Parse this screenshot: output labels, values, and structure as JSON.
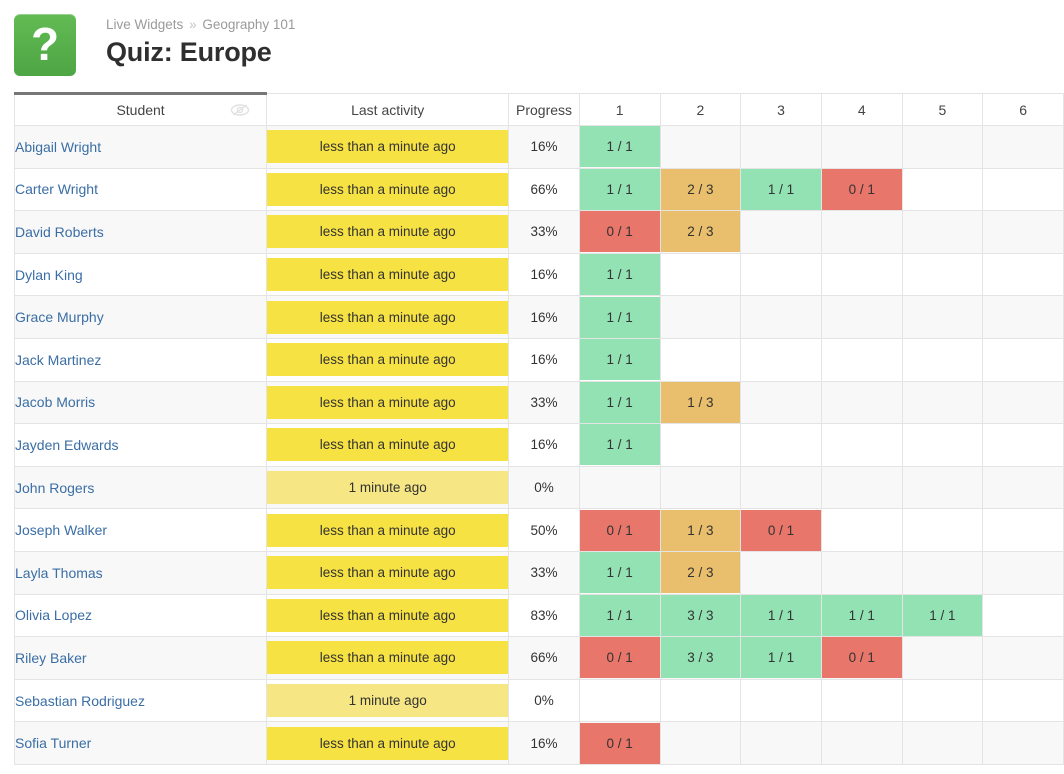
{
  "header": {
    "icon_name": "question-mark-icon",
    "icon_glyph": "?",
    "breadcrumb_root": "Live Widgets",
    "breadcrumb_separator": "»",
    "breadcrumb_course": "Geography 101",
    "title": "Quiz: Europe"
  },
  "colors": {
    "accent_green": "#4da544",
    "link_blue": "#3a6ea5",
    "score_green": "#93e2b3",
    "score_orange": "#e9bf6d",
    "score_red": "#e8766a",
    "activity_recent_yellow": "#f7e243",
    "activity_stale_yellow": "#f6e684",
    "row_stripe": "#f8f8f8"
  },
  "table": {
    "headers": {
      "student": "Student",
      "last_activity": "Last activity",
      "progress": "Progress",
      "hide_icon_name": "eye-slash-icon",
      "questions": [
        "1",
        "2",
        "3",
        "4",
        "5",
        "6"
      ]
    },
    "rows": [
      {
        "student": "Abigail Wright",
        "last_activity": "less than a minute ago",
        "activity_state": "recent",
        "progress": "16%",
        "scores": [
          {
            "text": "1 / 1",
            "state": "green"
          },
          {
            "text": "",
            "state": "none"
          },
          {
            "text": "",
            "state": "none"
          },
          {
            "text": "",
            "state": "none"
          },
          {
            "text": "",
            "state": "none"
          },
          {
            "text": "",
            "state": "none"
          }
        ]
      },
      {
        "student": "Carter Wright",
        "last_activity": "less than a minute ago",
        "activity_state": "recent",
        "progress": "66%",
        "scores": [
          {
            "text": "1 / 1",
            "state": "green"
          },
          {
            "text": "2 / 3",
            "state": "orange"
          },
          {
            "text": "1 / 1",
            "state": "green"
          },
          {
            "text": "0 / 1",
            "state": "red"
          },
          {
            "text": "",
            "state": "none"
          },
          {
            "text": "",
            "state": "none"
          }
        ]
      },
      {
        "student": "David Roberts",
        "last_activity": "less than a minute ago",
        "activity_state": "recent",
        "progress": "33%",
        "scores": [
          {
            "text": "0 / 1",
            "state": "red"
          },
          {
            "text": "2 / 3",
            "state": "orange"
          },
          {
            "text": "",
            "state": "none"
          },
          {
            "text": "",
            "state": "none"
          },
          {
            "text": "",
            "state": "none"
          },
          {
            "text": "",
            "state": "none"
          }
        ]
      },
      {
        "student": "Dylan King",
        "last_activity": "less than a minute ago",
        "activity_state": "recent",
        "progress": "16%",
        "scores": [
          {
            "text": "1 / 1",
            "state": "green"
          },
          {
            "text": "",
            "state": "none"
          },
          {
            "text": "",
            "state": "none"
          },
          {
            "text": "",
            "state": "none"
          },
          {
            "text": "",
            "state": "none"
          },
          {
            "text": "",
            "state": "none"
          }
        ]
      },
      {
        "student": "Grace Murphy",
        "last_activity": "less than a minute ago",
        "activity_state": "recent",
        "progress": "16%",
        "scores": [
          {
            "text": "1 / 1",
            "state": "green"
          },
          {
            "text": "",
            "state": "none"
          },
          {
            "text": "",
            "state": "none"
          },
          {
            "text": "",
            "state": "none"
          },
          {
            "text": "",
            "state": "none"
          },
          {
            "text": "",
            "state": "none"
          }
        ]
      },
      {
        "student": "Jack Martinez",
        "last_activity": "less than a minute ago",
        "activity_state": "recent",
        "progress": "16%",
        "scores": [
          {
            "text": "1 / 1",
            "state": "green"
          },
          {
            "text": "",
            "state": "none"
          },
          {
            "text": "",
            "state": "none"
          },
          {
            "text": "",
            "state": "none"
          },
          {
            "text": "",
            "state": "none"
          },
          {
            "text": "",
            "state": "none"
          }
        ]
      },
      {
        "student": "Jacob Morris",
        "last_activity": "less than a minute ago",
        "activity_state": "recent",
        "progress": "33%",
        "scores": [
          {
            "text": "1 / 1",
            "state": "green"
          },
          {
            "text": "1 / 3",
            "state": "orange"
          },
          {
            "text": "",
            "state": "none"
          },
          {
            "text": "",
            "state": "none"
          },
          {
            "text": "",
            "state": "none"
          },
          {
            "text": "",
            "state": "none"
          }
        ]
      },
      {
        "student": "Jayden Edwards",
        "last_activity": "less than a minute ago",
        "activity_state": "recent",
        "progress": "16%",
        "scores": [
          {
            "text": "1 / 1",
            "state": "green"
          },
          {
            "text": "",
            "state": "none"
          },
          {
            "text": "",
            "state": "none"
          },
          {
            "text": "",
            "state": "none"
          },
          {
            "text": "",
            "state": "none"
          },
          {
            "text": "",
            "state": "none"
          }
        ]
      },
      {
        "student": "John Rogers",
        "last_activity": "1 minute ago",
        "activity_state": "stale",
        "progress": "0%",
        "scores": [
          {
            "text": "",
            "state": "none"
          },
          {
            "text": "",
            "state": "none"
          },
          {
            "text": "",
            "state": "none"
          },
          {
            "text": "",
            "state": "none"
          },
          {
            "text": "",
            "state": "none"
          },
          {
            "text": "",
            "state": "none"
          }
        ]
      },
      {
        "student": "Joseph Walker",
        "last_activity": "less than a minute ago",
        "activity_state": "recent",
        "progress": "50%",
        "scores": [
          {
            "text": "0 / 1",
            "state": "red"
          },
          {
            "text": "1 / 3",
            "state": "orange"
          },
          {
            "text": "0 / 1",
            "state": "red"
          },
          {
            "text": "",
            "state": "none"
          },
          {
            "text": "",
            "state": "none"
          },
          {
            "text": "",
            "state": "none"
          }
        ]
      },
      {
        "student": "Layla Thomas",
        "last_activity": "less than a minute ago",
        "activity_state": "recent",
        "progress": "33%",
        "scores": [
          {
            "text": "1 / 1",
            "state": "green"
          },
          {
            "text": "2 / 3",
            "state": "orange"
          },
          {
            "text": "",
            "state": "none"
          },
          {
            "text": "",
            "state": "none"
          },
          {
            "text": "",
            "state": "none"
          },
          {
            "text": "",
            "state": "none"
          }
        ]
      },
      {
        "student": "Olivia Lopez",
        "last_activity": "less than a minute ago",
        "activity_state": "recent",
        "progress": "83%",
        "scores": [
          {
            "text": "1 / 1",
            "state": "green"
          },
          {
            "text": "3 / 3",
            "state": "green"
          },
          {
            "text": "1 / 1",
            "state": "green"
          },
          {
            "text": "1 / 1",
            "state": "green"
          },
          {
            "text": "1 / 1",
            "state": "green"
          },
          {
            "text": "",
            "state": "none"
          }
        ]
      },
      {
        "student": "Riley Baker",
        "last_activity": "less than a minute ago",
        "activity_state": "recent",
        "progress": "66%",
        "scores": [
          {
            "text": "0 / 1",
            "state": "red"
          },
          {
            "text": "3 / 3",
            "state": "green"
          },
          {
            "text": "1 / 1",
            "state": "green"
          },
          {
            "text": "0 / 1",
            "state": "red"
          },
          {
            "text": "",
            "state": "none"
          },
          {
            "text": "",
            "state": "none"
          }
        ]
      },
      {
        "student": "Sebastian Rodriguez",
        "last_activity": "1 minute ago",
        "activity_state": "stale",
        "progress": "0%",
        "scores": [
          {
            "text": "",
            "state": "none"
          },
          {
            "text": "",
            "state": "none"
          },
          {
            "text": "",
            "state": "none"
          },
          {
            "text": "",
            "state": "none"
          },
          {
            "text": "",
            "state": "none"
          },
          {
            "text": "",
            "state": "none"
          }
        ]
      },
      {
        "student": "Sofia Turner",
        "last_activity": "less than a minute ago",
        "activity_state": "recent",
        "progress": "16%",
        "scores": [
          {
            "text": "0 / 1",
            "state": "red"
          },
          {
            "text": "",
            "state": "none"
          },
          {
            "text": "",
            "state": "none"
          },
          {
            "text": "",
            "state": "none"
          },
          {
            "text": "",
            "state": "none"
          },
          {
            "text": "",
            "state": "none"
          }
        ]
      }
    ]
  }
}
